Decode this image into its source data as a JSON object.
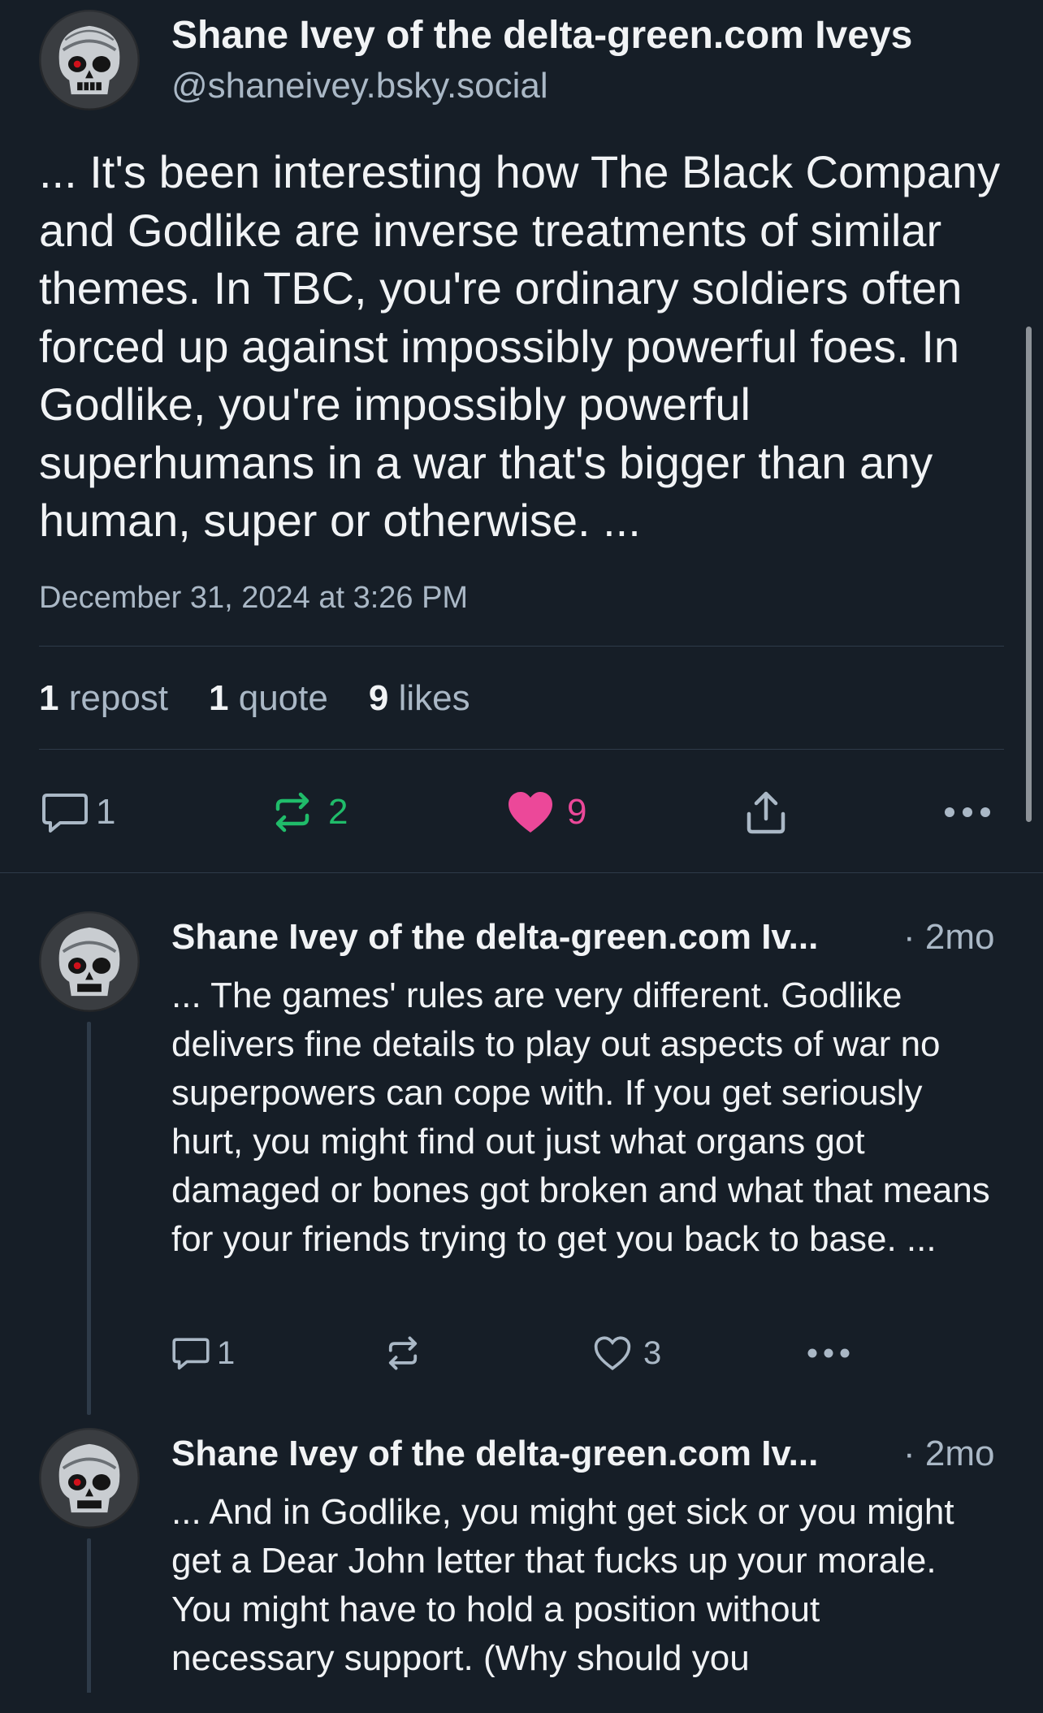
{
  "main_post": {
    "display_name": "Shane Ivey of the delta-green.com Iveys",
    "handle": "@shaneivey.bsky.social",
    "text": "... It's been interesting how The Black Company and Godlike are inverse treatments of similar themes. In TBC, you're ordinary soldiers often forced up against impossibly powerful foes. In Godlike, you're impossibly powerful superhumans in a war that's bigger than any human, super or otherwise. ...",
    "timestamp": "December 31, 2024 at 3:26 PM",
    "stats": {
      "reposts_count": "1",
      "reposts_label": "repost",
      "quotes_count": "1",
      "quotes_label": "quote",
      "likes_count": "9",
      "likes_label": "likes"
    },
    "actions": {
      "reply_count": "1",
      "repost_count": "2",
      "like_count": "9"
    },
    "colors": {
      "repost_active": "#20bc6a",
      "like_active": "#ec4899"
    }
  },
  "replies": [
    {
      "display_name": "Shane Ivey of the delta-green.com Iv...",
      "age": "· 2mo",
      "text": "... The games' rules are very different. Godlike delivers fine details to play out aspects of war no superpowers can cope with. If you get seriously hurt, you might find out just what organs got damaged or bones got broken and what that means for your friends trying to get you back to base. ...",
      "reply_count": "1",
      "repost_count": "",
      "like_count": "3"
    },
    {
      "display_name": "Shane Ivey of the delta-green.com Iv...",
      "age": "· 2mo",
      "text": "... And in Godlike, you might get sick or you might get a Dear John letter that fucks up your morale. You might have to hold a position without necessary support. (Why should you",
      "reply_count": "",
      "repost_count": "",
      "like_count": ""
    }
  ],
  "icons": {
    "reply": "speech-bubble-icon",
    "repost": "repost-arrows-icon",
    "like": "heart-icon",
    "share": "share-upload-icon",
    "more": "ellipsis-icon"
  }
}
